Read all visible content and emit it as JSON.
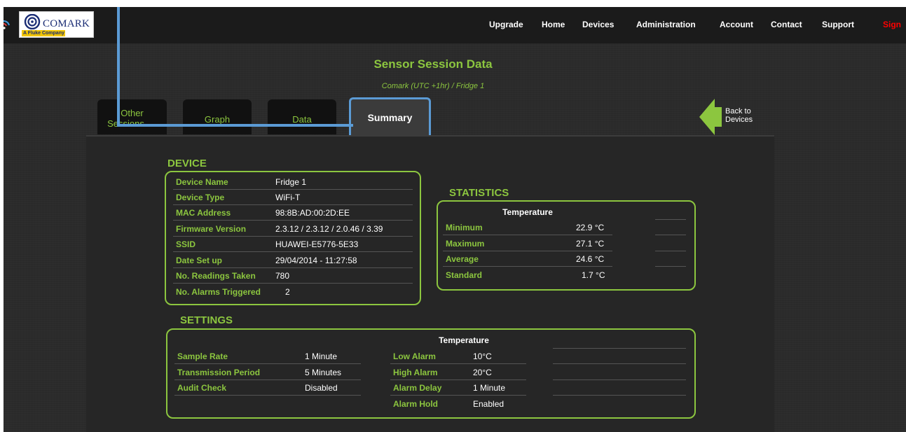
{
  "header": {
    "brand": "COMARK",
    "brand_sub": "A Fluke Company",
    "nav": [
      "Upgrade",
      "Home",
      "Devices",
      "Administration",
      "Account",
      "Contact",
      "Support",
      "Sign"
    ]
  },
  "page": {
    "title": "Sensor Session Data",
    "subtitle": "Comark  (UTC +1hr) / Fridge 1"
  },
  "tabs": {
    "other": [
      "Other",
      "Sessions"
    ],
    "graph": "Graph",
    "data": "Data",
    "summary": "Summary"
  },
  "back": [
    "Back to",
    "Devices"
  ],
  "device": {
    "heading": "DEVICE",
    "rows": [
      {
        "label": "Device Name",
        "value": "Fridge 1"
      },
      {
        "label": "Device Type",
        "value": "WiFi-T"
      },
      {
        "label": "MAC Address",
        "value": "98:8B:AD:00:2D:EE"
      },
      {
        "label": "Firmware Version",
        "value": "2.3.12 / 2.3.12 / 2.0.46 / 3.39"
      },
      {
        "label": "SSID",
        "value": "HUAWEI-E5776-5E33"
      },
      {
        "label": "Date Set up",
        "value": "29/04/2014 - 11:27:58"
      },
      {
        "label": "No. Readings Taken",
        "value": "780"
      },
      {
        "label": "No. Alarms Triggered",
        "value": "2"
      }
    ]
  },
  "statistics": {
    "heading": "STATISTICS",
    "column": "Temperature",
    "rows": [
      {
        "label": "Minimum",
        "value": "22.9 °C"
      },
      {
        "label": "Maximum",
        "value": "27.1 °C"
      },
      {
        "label": "Average",
        "value": "24.6 °C"
      },
      {
        "label": "Standard",
        "value": "1.7 °C"
      }
    ]
  },
  "settings": {
    "heading": "SETTINGS",
    "column": "Temperature",
    "left": [
      {
        "label": "Sample Rate",
        "value": "1 Minute"
      },
      {
        "label": "Transmission Period",
        "value": "5 Minutes"
      },
      {
        "label": "Audit Check",
        "value": "Disabled"
      }
    ],
    "right": [
      {
        "label": "Low Alarm",
        "value": "10°C"
      },
      {
        "label": "High Alarm",
        "value": "20°C"
      },
      {
        "label": "Alarm Delay",
        "value": "1 Minute"
      },
      {
        "label": "Alarm Hold",
        "value": "Enabled"
      }
    ]
  },
  "colors": {
    "accent": "#8cc63f",
    "highlight": "#5b9bd5",
    "signout": "#ff0000",
    "background": "#2b2b2b"
  }
}
